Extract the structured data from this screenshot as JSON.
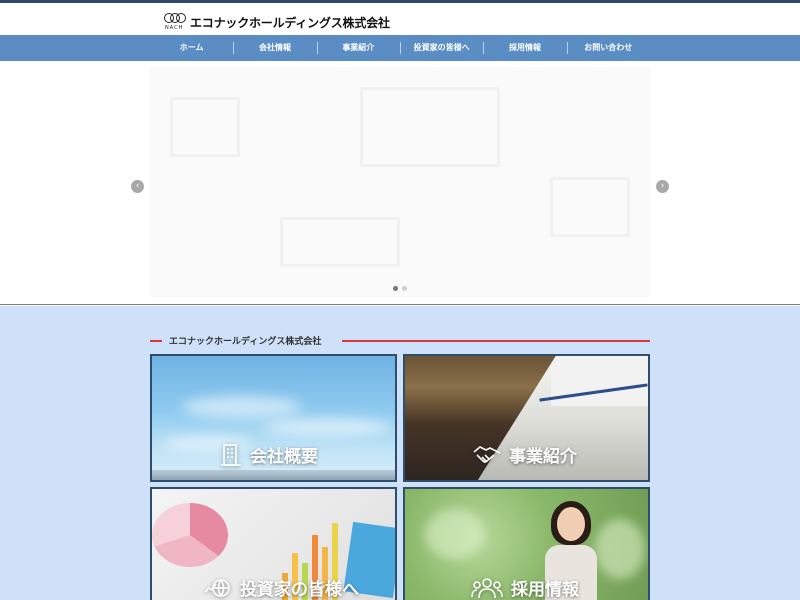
{
  "header": {
    "logo_sub": "NACH",
    "company_name": "エコナックホールディングス株式会社"
  },
  "nav": {
    "items": [
      {
        "label": "ホーム"
      },
      {
        "label": "会社情報"
      },
      {
        "label": "事業紹介"
      },
      {
        "label": "投資家の皆様へ"
      },
      {
        "label": "採用情報"
      },
      {
        "label": "お問い合わせ"
      }
    ]
  },
  "slider": {
    "slide_count": 2,
    "active_index": 0
  },
  "section": {
    "title": "エコナックホールディングス株式会社"
  },
  "tiles": [
    {
      "label": "会社概要",
      "icon": "building-icon"
    },
    {
      "label": "事業紹介",
      "icon": "handshake-icon"
    },
    {
      "label": "投資家の皆様へ",
      "icon": "chart-globe-icon"
    },
    {
      "label": "採用情報",
      "icon": "people-icon"
    }
  ],
  "colors": {
    "nav_bg": "#5a8dc4",
    "content_bg": "#cfe0f9",
    "accent_line": "#d83a3a",
    "tile_border": "#2e4f6c"
  }
}
